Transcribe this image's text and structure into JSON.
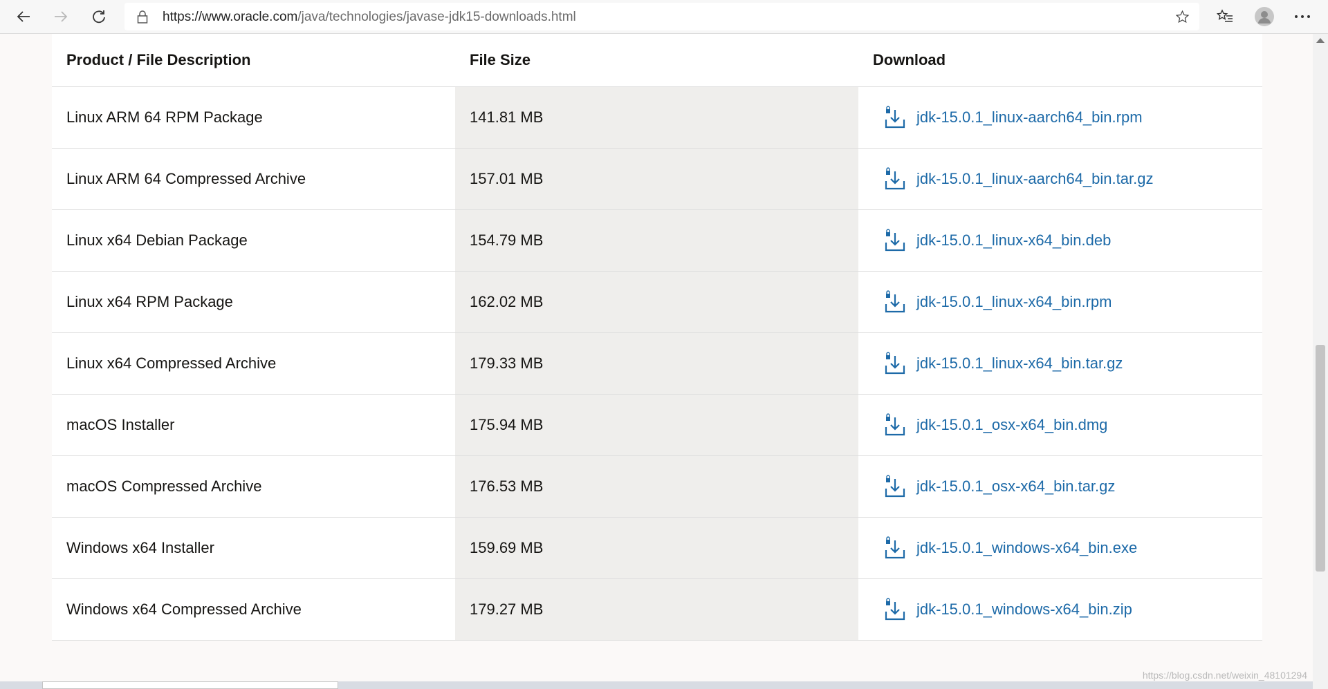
{
  "browser": {
    "url_prefix": "https://www.oracle.com",
    "url_path": "/java/technologies/javase-jdk15-downloads.html",
    "icons": [
      "back-arrow-icon",
      "forward-arrow-icon",
      "refresh-icon",
      "lock-icon",
      "star-icon",
      "favorites-icon",
      "profile-icon",
      "more-icon"
    ]
  },
  "table": {
    "headers": {
      "product": "Product / File Description",
      "size": "File Size",
      "download": "Download"
    },
    "rows": [
      {
        "product": "Linux ARM 64 RPM Package",
        "size": "141.81 MB",
        "file": "jdk-15.0.1_linux-aarch64_bin.rpm"
      },
      {
        "product": "Linux ARM 64 Compressed Archive",
        "size": "157.01 MB",
        "file": "jdk-15.0.1_linux-aarch64_bin.tar.gz"
      },
      {
        "product": "Linux x64 Debian Package",
        "size": "154.79 MB",
        "file": "jdk-15.0.1_linux-x64_bin.deb"
      },
      {
        "product": "Linux x64 RPM Package",
        "size": "162.02 MB",
        "file": "jdk-15.0.1_linux-x64_bin.rpm"
      },
      {
        "product": "Linux x64 Compressed Archive",
        "size": "179.33 MB",
        "file": "jdk-15.0.1_linux-x64_bin.tar.gz"
      },
      {
        "product": "macOS Installer",
        "size": "175.94 MB",
        "file": "jdk-15.0.1_osx-x64_bin.dmg"
      },
      {
        "product": "macOS Compressed Archive",
        "size": "176.53 MB",
        "file": "jdk-15.0.1_osx-x64_bin.tar.gz"
      },
      {
        "product": "Windows x64 Installer",
        "size": "159.69 MB",
        "file": "jdk-15.0.1_windows-x64_bin.exe"
      },
      {
        "product": "Windows x64 Compressed Archive",
        "size": "179.27 MB",
        "file": "jdk-15.0.1_windows-x64_bin.zip"
      }
    ]
  },
  "watermark": "https://blog.csdn.net/weixin_48101294",
  "colors": {
    "link": "#1d6aa8",
    "size_column_bg": "#efeeec",
    "text": "#161513"
  }
}
